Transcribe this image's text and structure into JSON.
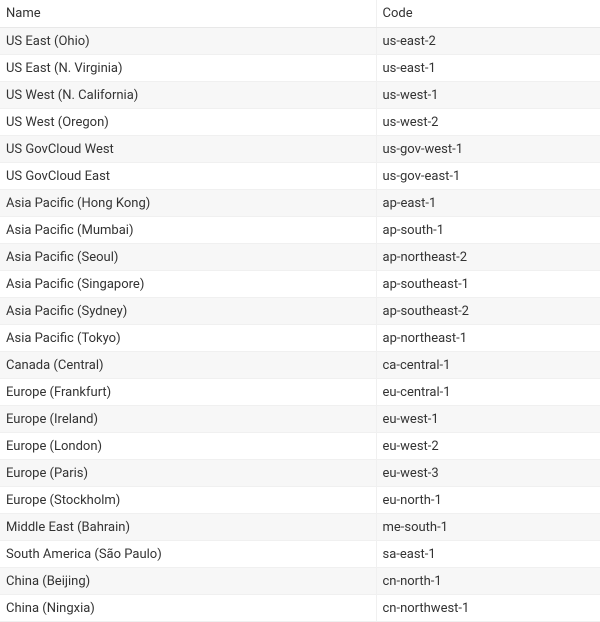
{
  "table": {
    "headers": {
      "name": "Name",
      "code": "Code"
    },
    "rows": [
      {
        "name": "US East (Ohio)",
        "code": "us-east-2"
      },
      {
        "name": "US East (N. Virginia)",
        "code": "us-east-1"
      },
      {
        "name": "US West (N. California)",
        "code": "us-west-1"
      },
      {
        "name": "US West (Oregon)",
        "code": "us-west-2"
      },
      {
        "name": "US GovCloud West",
        "code": "us-gov-west-1"
      },
      {
        "name": "US GovCloud East",
        "code": "us-gov-east-1"
      },
      {
        "name": "Asia Pacific (Hong Kong)",
        "code": "ap-east-1"
      },
      {
        "name": "Asia Pacific (Mumbai)",
        "code": "ap-south-1"
      },
      {
        "name": "Asia Pacific (Seoul)",
        "code": "ap-northeast-2"
      },
      {
        "name": "Asia Pacific (Singapore)",
        "code": "ap-southeast-1"
      },
      {
        "name": "Asia Pacific (Sydney)",
        "code": "ap-southeast-2"
      },
      {
        "name": "Asia Pacific (Tokyo)",
        "code": "ap-northeast-1"
      },
      {
        "name": "Canada (Central)",
        "code": "ca-central-1"
      },
      {
        "name": "Europe (Frankfurt)",
        "code": "eu-central-1"
      },
      {
        "name": "Europe (Ireland)",
        "code": "eu-west-1"
      },
      {
        "name": "Europe (London)",
        "code": "eu-west-2"
      },
      {
        "name": "Europe (Paris)",
        "code": "eu-west-3"
      },
      {
        "name": "Europe (Stockholm)",
        "code": "eu-north-1"
      },
      {
        "name": "Middle East (Bahrain)",
        "code": "me-south-1"
      },
      {
        "name": "South America (São Paulo)",
        "code": "sa-east-1"
      },
      {
        "name": "China (Beijing)",
        "code": "cn-north-1"
      },
      {
        "name": "China (Ningxia)",
        "code": "cn-northwest-1"
      }
    ]
  }
}
